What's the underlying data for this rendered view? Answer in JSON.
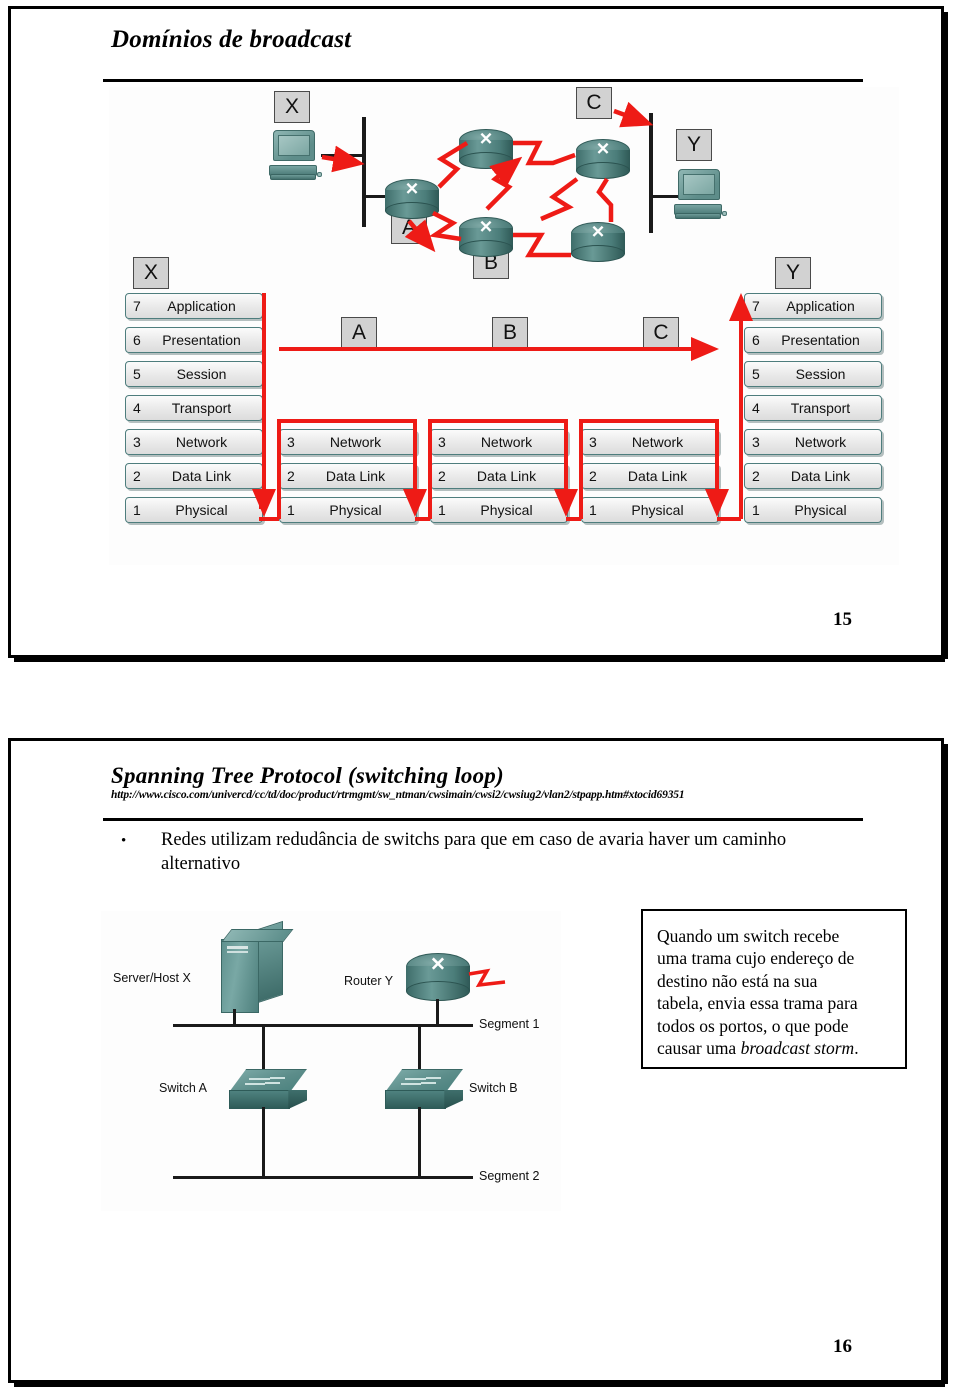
{
  "document": {
    "page_numbers": [
      "15",
      "16"
    ]
  },
  "slide1": {
    "title": "Domínios de broadcast",
    "page_number": "15",
    "diagram": {
      "name": "broadcast-domains-osi-diagram",
      "top_nodes": [
        {
          "id": "chip-x-top",
          "label": "X"
        },
        {
          "id": "chip-y-top",
          "label": "Y"
        },
        {
          "id": "chip-a",
          "label": "A"
        },
        {
          "id": "chip-b",
          "label": "B"
        },
        {
          "id": "chip-c",
          "label": "C"
        }
      ],
      "stack_headers": [
        {
          "id": "hdr-x",
          "label": "X"
        },
        {
          "id": "hdr-a",
          "label": "A"
        },
        {
          "id": "hdr-b",
          "label": "B"
        },
        {
          "id": "hdr-c",
          "label": "C"
        },
        {
          "id": "hdr-y",
          "label": "Y"
        }
      ],
      "full_stack": [
        {
          "num": "7",
          "name": "Application"
        },
        {
          "num": "6",
          "name": "Presentation"
        },
        {
          "num": "5",
          "name": "Session"
        },
        {
          "num": "4",
          "name": "Transport"
        },
        {
          "num": "3",
          "name": "Network"
        },
        {
          "num": "2",
          "name": "Data Link"
        },
        {
          "num": "1",
          "name": "Physical"
        }
      ],
      "router_stack": [
        {
          "num": "3",
          "name": "Network"
        },
        {
          "num": "2",
          "name": "Data Link"
        },
        {
          "num": "1",
          "name": "Physical"
        }
      ],
      "colors": {
        "path": "#ee1b16",
        "device": "#4e7d7d",
        "chip": "#d2d2d2"
      }
    }
  },
  "slide2": {
    "title": "Spanning Tree Protocol (switching loop)",
    "url": "http://www.cisco.com/univercd/cc/td/doc/product/rtrmgmt/sw_ntman/cwsimain/cwsi2/cwsiug2/vlan2/stpapp.htm#xtocid69351",
    "bullet": "Redes utilizam redudância de switchs para que em caso de avaria haver um caminho alternativo",
    "bullet_marker": "•",
    "page_number": "16",
    "callout": "Quando um switch recebe uma trama cujo endereço de destino não está na sua tabela, envia essa trama para todos os portos, o que pode causar uma broadcast storm.",
    "callout_parts": {
      "line1": "Quando um switch recebe",
      "line2": "uma trama cujo endereço de",
      "line3": "destino não está na sua",
      "line4": "tabela, envia essa trama para",
      "line5": "todos os portos, o que pode",
      "line6_plain": "causar uma ",
      "line6_italic": "broadcast storm",
      "line6_end": "."
    },
    "diagram": {
      "name": "switching-loop-diagram",
      "labels": [
        {
          "id": "server-host-x",
          "text": "Server/Host X"
        },
        {
          "id": "router-y",
          "text": "Router Y"
        },
        {
          "id": "segment-1",
          "text": "Segment 1"
        },
        {
          "id": "switch-a",
          "text": "Switch A"
        },
        {
          "id": "switch-b",
          "text": "Switch B"
        },
        {
          "id": "segment-2",
          "text": "Segment 2"
        }
      ]
    }
  }
}
